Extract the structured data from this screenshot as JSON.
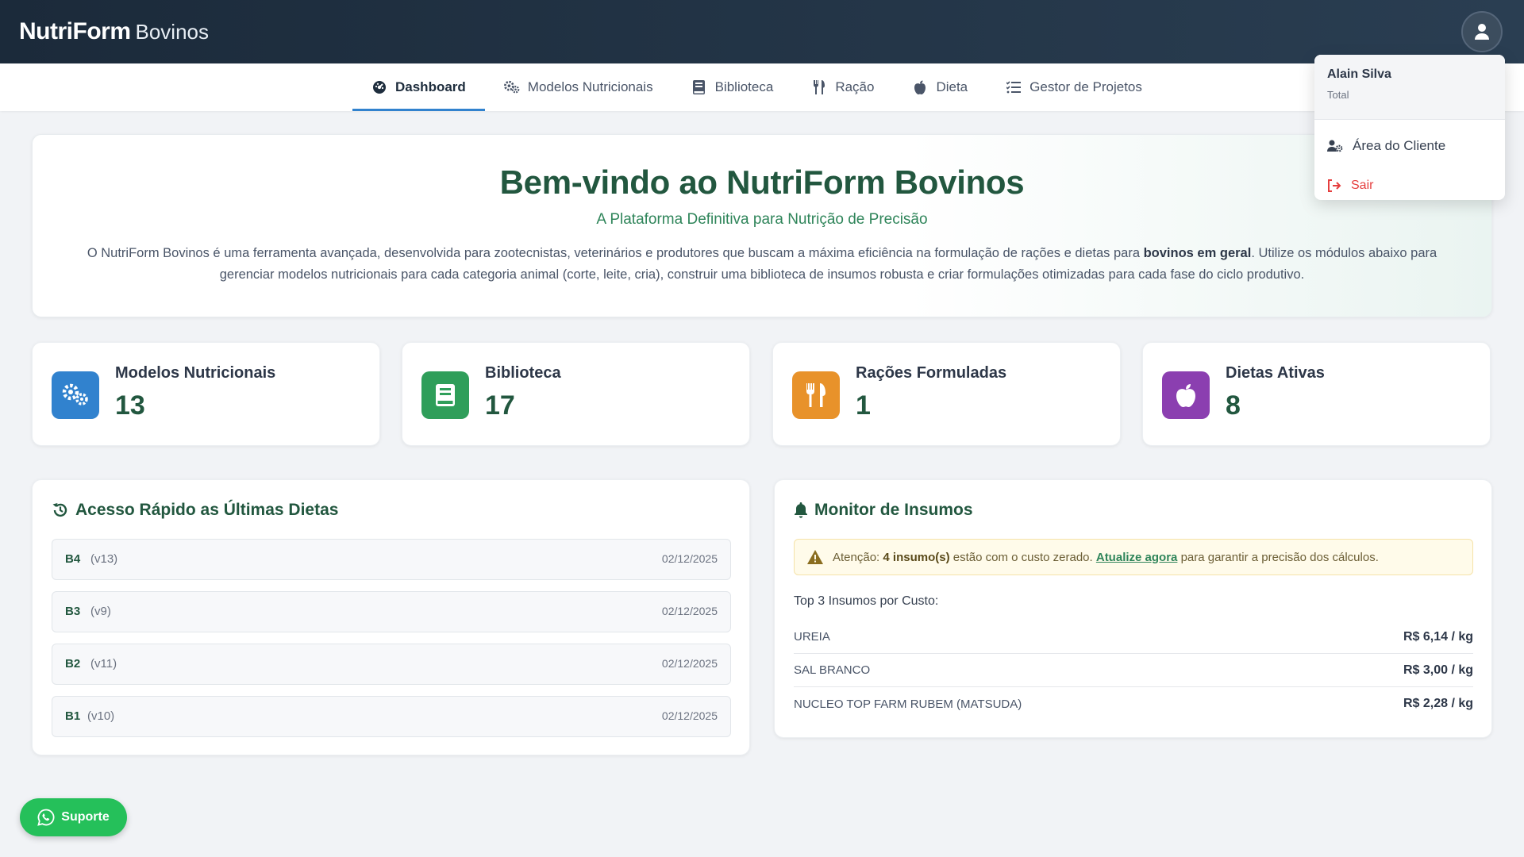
{
  "header": {
    "brand_strong": "NutriForm",
    "brand_light": "Bovinos",
    "avatar_icon": "user-icon"
  },
  "nav": {
    "tabs": [
      {
        "label": "Dashboard",
        "icon": "dashboard-icon",
        "active": true
      },
      {
        "label": "Modelos Nutricionais",
        "icon": "gears-icon"
      },
      {
        "label": "Biblioteca",
        "icon": "book-icon"
      },
      {
        "label": "Ração",
        "icon": "utensils-icon"
      },
      {
        "label": "Dieta",
        "icon": "apple-icon"
      },
      {
        "label": "Gestor de Projetos",
        "icon": "list-check-icon"
      }
    ]
  },
  "user_menu": {
    "name": "Alain Silva",
    "plan": "Total",
    "client_area": "Área do Cliente",
    "logout": "Sair"
  },
  "welcome": {
    "title": "Bem-vindo ao NutriForm Bovinos",
    "subtitle": "A Plataforma Definitiva para Nutrição de Precisão",
    "desc_before": "O NutriForm Bovinos é uma ferramenta avançada, desenvolvida para zootecnistas, veterinários e produtores que buscam a máxima eficiência na formulação de rações e dietas para ",
    "desc_bold": "bovinos em geral",
    "desc_after": ". Utilize os módulos abaixo para gerenciar modelos nutricionais para cada categoria animal (corte, leite, cria), construir uma biblioteca de insumos robusta e criar formulações otimizadas para cada fase do ciclo produtivo."
  },
  "stats": [
    {
      "label": "Modelos Nutricionais",
      "value": "13",
      "icon": "gears-icon",
      "color": "#3182ce"
    },
    {
      "label": "Biblioteca",
      "value": "17",
      "icon": "book-icon",
      "color": "#2f9e5a"
    },
    {
      "label": "Rações Formuladas",
      "value": "1",
      "icon": "utensils-icon",
      "color": "#e8922a"
    },
    {
      "label": "Dietas Ativas",
      "value": "8",
      "icon": "apple-icon",
      "color": "#8b3fb0"
    }
  ],
  "recent_diets": {
    "title": "Acesso Rápido as Últimas Dietas",
    "items": [
      {
        "name": "B4",
        "version": "(v13)",
        "date": "02/12/2025"
      },
      {
        "name": "B3",
        "version": "(v9)",
        "date": "02/12/2025"
      },
      {
        "name": "B2",
        "version": "(v11)",
        "date": "02/12/2025"
      },
      {
        "name": "B1",
        "version": "(v10)",
        "date": "02/12/2025"
      }
    ]
  },
  "monitor": {
    "title": "Monitor de Insumos",
    "alert_prefix": "Atenção:",
    "alert_bold": "4 insumo(s)",
    "alert_mid": "estão com o custo zerado.",
    "alert_link": "Atualize agora",
    "alert_suffix": "para garantir a precisão dos cálculos.",
    "top_label": "Top 3 Insumos por Custo:",
    "items": [
      {
        "name": "UREIA",
        "cost": "R$ 6,14 / kg"
      },
      {
        "name": "SAL BRANCO",
        "cost": "R$ 3,00 / kg"
      },
      {
        "name": "NUCLEO TOP FARM RUBEM (MATSUDA)",
        "cost": "R$ 2,28 / kg"
      }
    ]
  },
  "support": {
    "label": "Suporte",
    "icon": "whatsapp-icon"
  }
}
